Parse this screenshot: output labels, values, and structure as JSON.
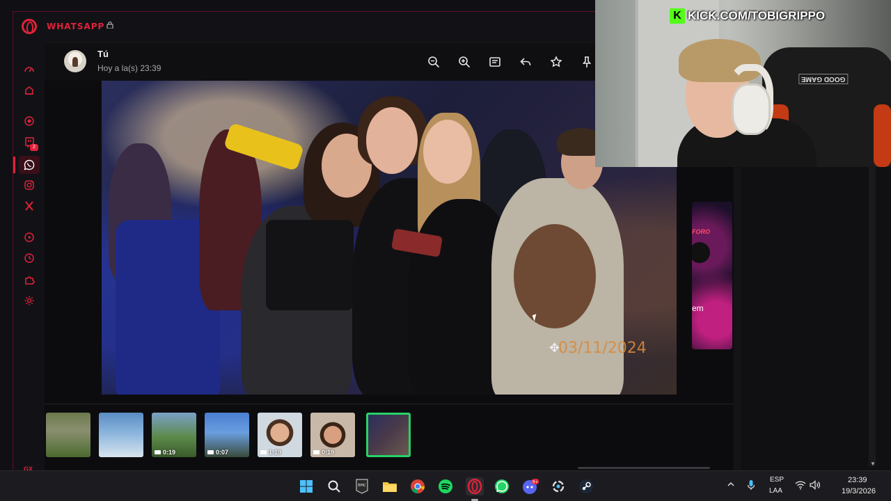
{
  "browser": {
    "panel_title": "WHATSAPP",
    "side_badge": "2",
    "footer_label": "GX",
    "more_label": "···"
  },
  "viewer": {
    "sender_name": "Tú",
    "sender_time": "Hoy a la(s) 23:39",
    "photo_timestamp": "03/11/2024",
    "side_preview_brand": "FORO",
    "side_preview_text": "em",
    "thumbnails": [
      {
        "type": "image",
        "duration": ""
      },
      {
        "type": "image",
        "duration": ""
      },
      {
        "type": "video",
        "duration": "0:19"
      },
      {
        "type": "video",
        "duration": "0:07"
      },
      {
        "type": "video",
        "duration": "1:19"
      },
      {
        "type": "video",
        "duration": "0:19"
      },
      {
        "type": "image",
        "duration": "",
        "selected": true
      }
    ]
  },
  "overlay": {
    "stream_url": "KICK.COM/TOBIGRIPPO",
    "chair_label": "GOOD GAME"
  },
  "taskbar": {
    "lang_top": "ESP",
    "lang_bottom": "LAA",
    "time": "23:39",
    "date": "19/3/2026",
    "discord_badge": "9+"
  },
  "colors": {
    "accent": "#e0223a",
    "whatsapp_green": "#25d366",
    "kick_green": "#53fc18"
  }
}
